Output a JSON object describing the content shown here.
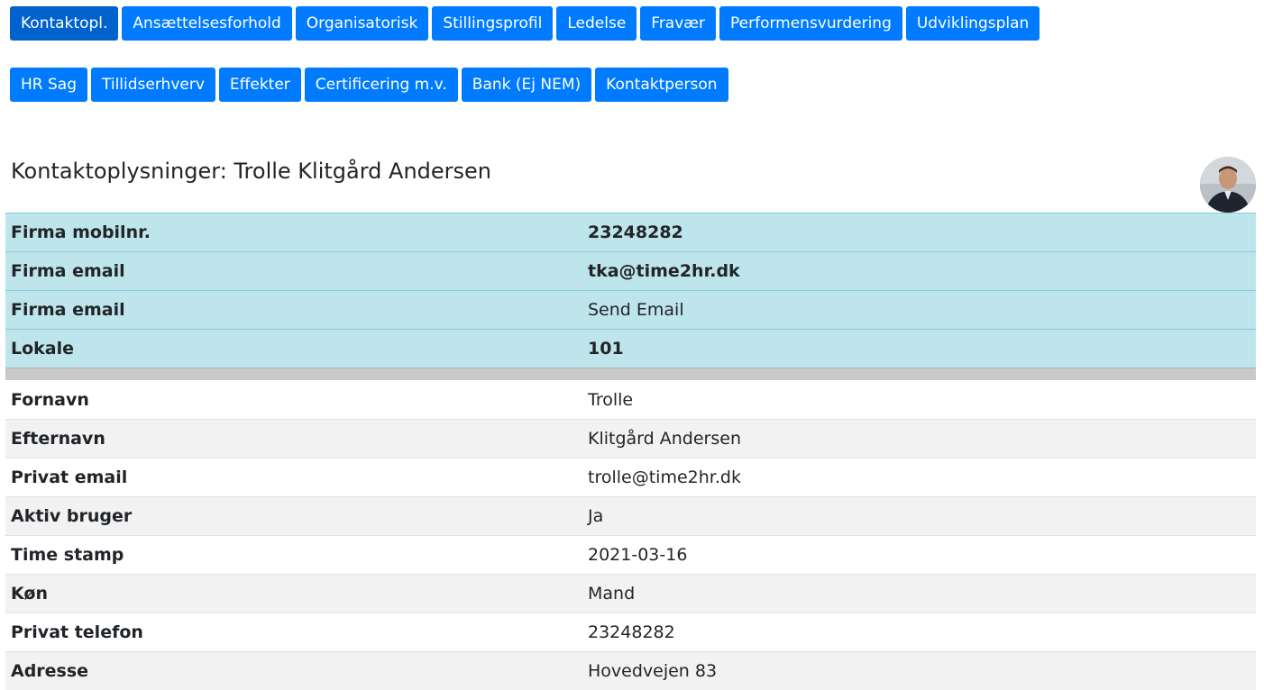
{
  "tabs_row1": [
    {
      "label": "Kontaktopl.",
      "active": true
    },
    {
      "label": "Ansættelsesforhold"
    },
    {
      "label": "Organisatorisk"
    },
    {
      "label": "Stillingsprofil"
    },
    {
      "label": "Ledelse"
    },
    {
      "label": "Fravær"
    },
    {
      "label": "Performensvurdering"
    },
    {
      "label": "Udviklingsplan"
    }
  ],
  "tabs_row2": [
    {
      "label": "HR Sag"
    },
    {
      "label": "Tillidserhverv"
    },
    {
      "label": "Effekter"
    },
    {
      "label": "Certificering m.v."
    },
    {
      "label": "Bank (Ej NEM)"
    },
    {
      "label": "Kontaktperson"
    }
  ],
  "heading": "Kontaktoplysninger: Trolle Klitgård Andersen",
  "company_rows": [
    {
      "label": "Firma mobilnr.",
      "value": "23248282"
    },
    {
      "label": "Firma email",
      "value": "tka@time2hr.dk"
    },
    {
      "label": "Firma email",
      "value": "Send Email"
    },
    {
      "label": "Lokale",
      "value": "101"
    }
  ],
  "personal_rows": [
    {
      "label": "Fornavn",
      "value": "Trolle"
    },
    {
      "label": "Efternavn",
      "value": "Klitgård Andersen"
    },
    {
      "label": "Privat email",
      "value": "trolle@time2hr.dk"
    },
    {
      "label": "Aktiv bruger",
      "value": "Ja"
    },
    {
      "label": "Time stamp",
      "value": "2021-03-16"
    },
    {
      "label": "Køn",
      "value": "Mand"
    },
    {
      "label": "Privat telefon",
      "value": "23248282"
    },
    {
      "label": "Adresse",
      "value": "Hovedvejen 83"
    }
  ],
  "colors": {
    "tab_bg": "#007bff",
    "tab_active_bg": "#0062cc",
    "info_row_bg": "#bee5eb",
    "stripe_bg": "#f2f2f2"
  }
}
